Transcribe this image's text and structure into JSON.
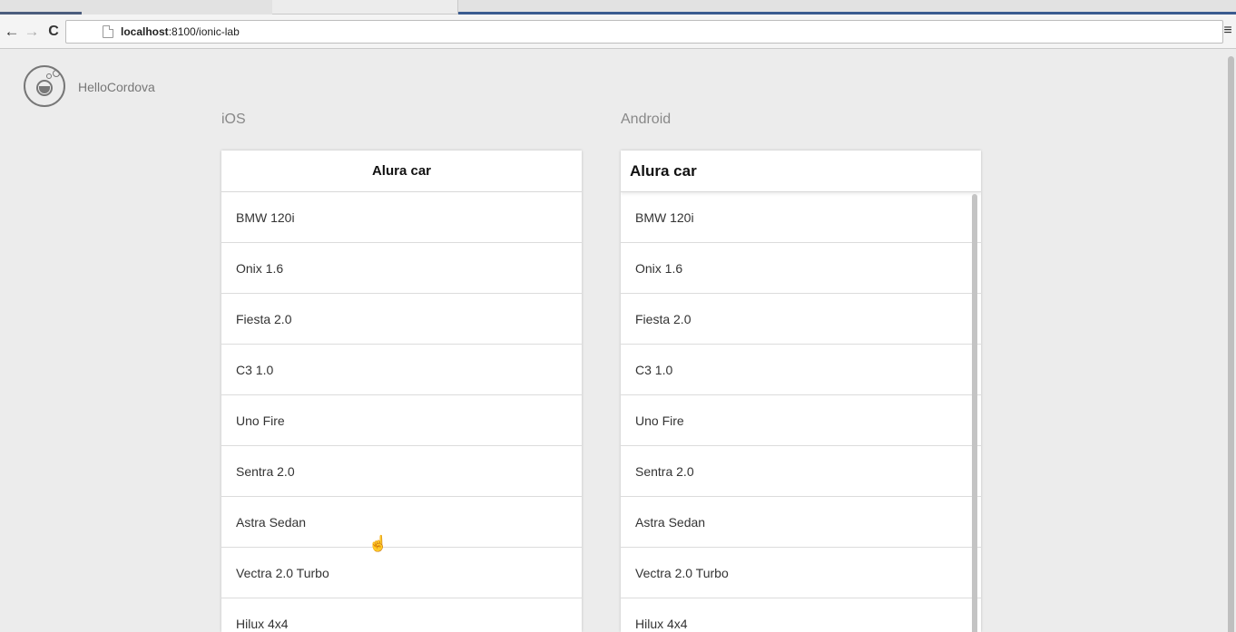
{
  "browser": {
    "url_host": "localhost",
    "url_rest": ":8100/ionic-lab",
    "back_icon": "←",
    "forward_icon": "→",
    "reload_icon": "C",
    "menu_icon": "≡"
  },
  "app": {
    "name": "HelloCordova"
  },
  "platforms": {
    "ios": {
      "label": "iOS",
      "title": "Alura car"
    },
    "android": {
      "label": "Android",
      "title": "Alura car"
    }
  },
  "cars": [
    {
      "name": "BMW 120i"
    },
    {
      "name": "Onix 1.6"
    },
    {
      "name": "Fiesta 2.0"
    },
    {
      "name": "C3 1.0"
    },
    {
      "name": "Uno Fire"
    },
    {
      "name": "Sentra 2.0"
    },
    {
      "name": "Astra Sedan"
    },
    {
      "name": "Vectra 2.0 Turbo"
    },
    {
      "name": "Hilux 4x4"
    }
  ],
  "cursor_icon": "☝"
}
